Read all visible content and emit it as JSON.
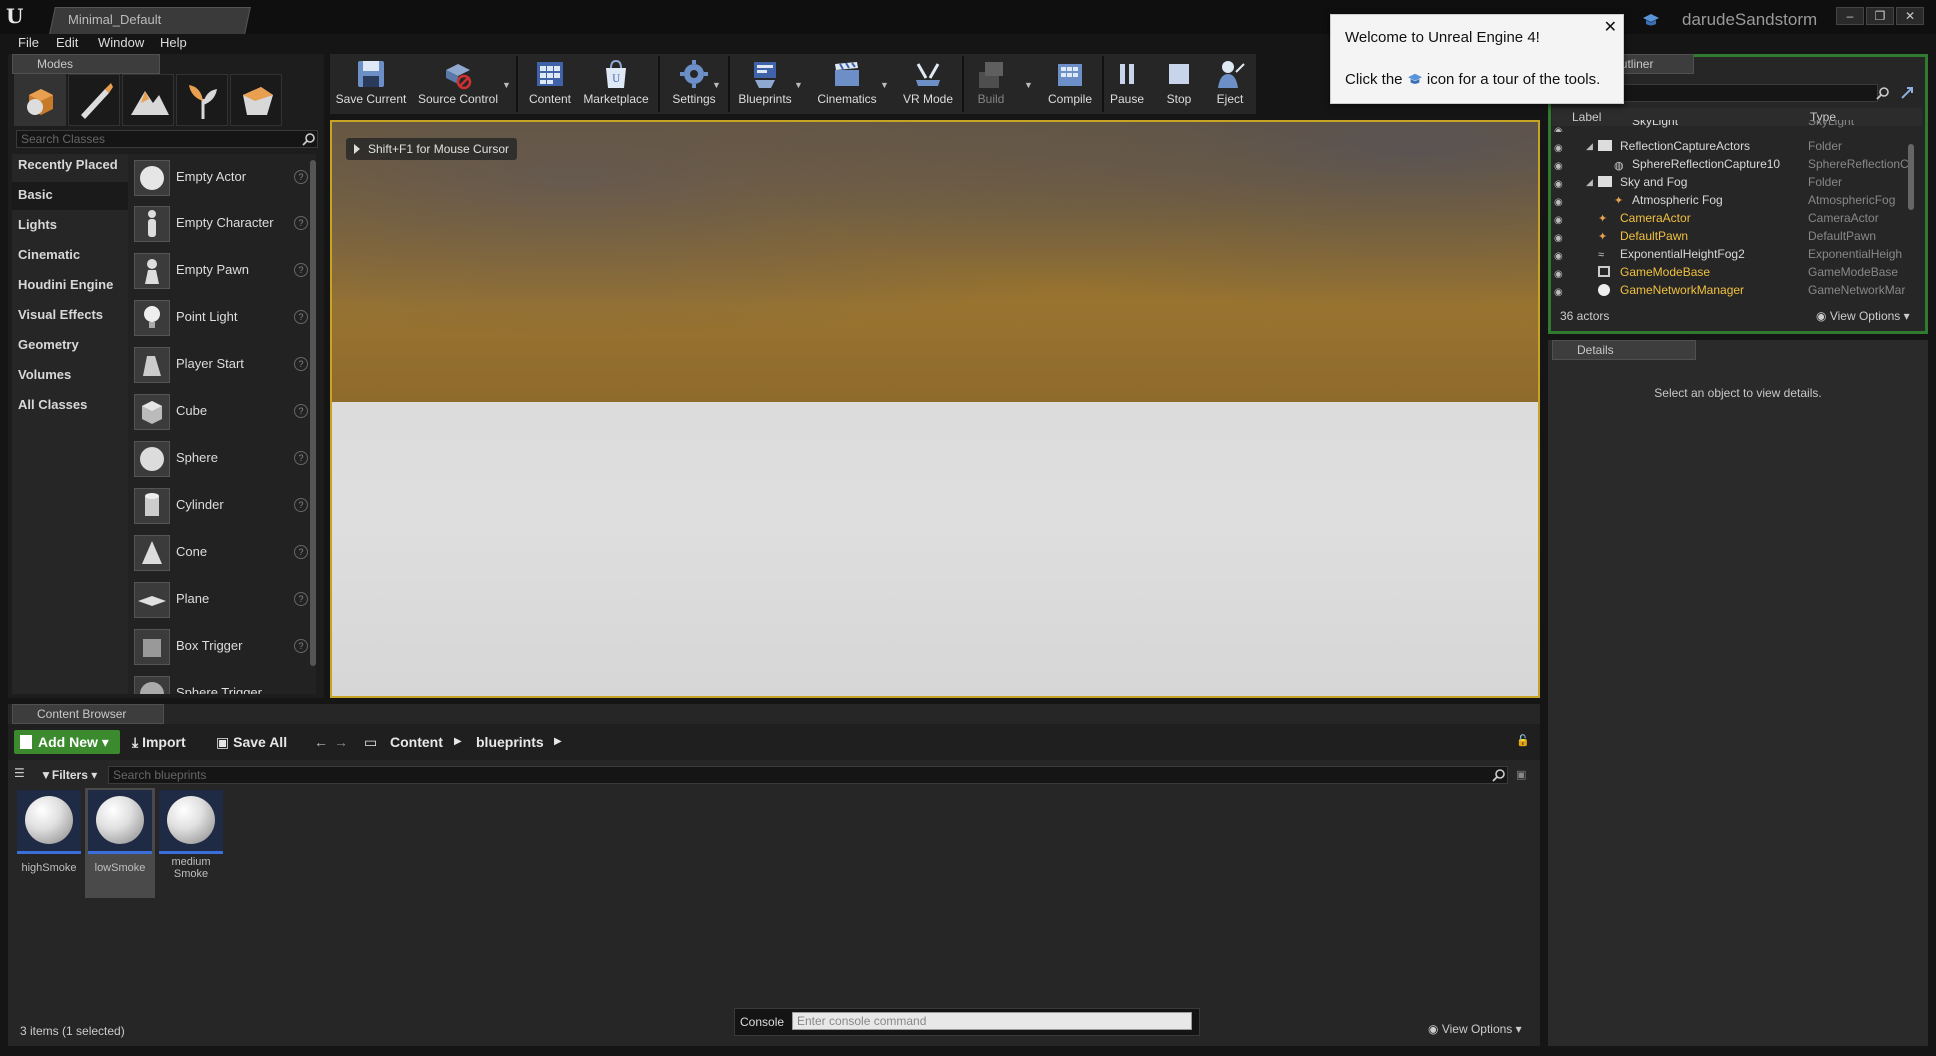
{
  "window": {
    "doc_tab": "Minimal_Default",
    "user": "darudeSandstorm",
    "controls": [
      "–",
      "❐",
      "✕"
    ]
  },
  "menu": [
    "File",
    "Edit",
    "Window",
    "Help"
  ],
  "modes": {
    "tab": "Modes",
    "search_placeholder": "Search Classes",
    "categories": [
      "Recently Placed",
      "Basic",
      "Lights",
      "Cinematic",
      "Houdini Engine",
      "Visual Effects",
      "Geometry",
      "Volumes",
      "All Classes"
    ],
    "selected_category": "Basic",
    "items": [
      "Empty Actor",
      "Empty Character",
      "Empty Pawn",
      "Point Light",
      "Player Start",
      "Cube",
      "Sphere",
      "Cylinder",
      "Cone",
      "Plane",
      "Box Trigger",
      "Sphere Trigger"
    ]
  },
  "toolbar": {
    "save_current": "Save Current",
    "source_control": "Source Control",
    "content": "Content",
    "marketplace": "Marketplace",
    "settings": "Settings",
    "blueprints": "Blueprints",
    "cinematics": "Cinematics",
    "vr_mode": "VR Mode",
    "build": "Build",
    "compile": "Compile",
    "pause": "Pause",
    "stop": "Stop",
    "eject": "Eject"
  },
  "viewport": {
    "hint": "Shift+F1 for Mouse Cursor"
  },
  "welcome": {
    "title": "Welcome to Unreal Engine 4!",
    "body_before": "Click the",
    "body_after": "icon for a tour of the tools."
  },
  "outliner": {
    "tab": "World Outliner",
    "col_label": "Label",
    "col_type": "Type",
    "rows": [
      {
        "label": "SkyLight",
        "type": "SkyLight"
      },
      {
        "label": "ReflectionCaptureActors",
        "type": "Folder"
      },
      {
        "label": "SphereReflectionCapture10",
        "type": "SphereReflectionC"
      },
      {
        "label": "Sky and Fog",
        "type": "Folder"
      },
      {
        "label": "Atmospheric Fog",
        "type": "AtmosphericFog"
      },
      {
        "label": "CameraActor",
        "type": "CameraActor"
      },
      {
        "label": "DefaultPawn",
        "type": "DefaultPawn"
      },
      {
        "label": "ExponentialHeightFog2",
        "type": "ExponentialHeigh"
      },
      {
        "label": "GameModeBase",
        "type": "GameModeBase"
      },
      {
        "label": "GameNetworkManager",
        "type": "GameNetworkMar"
      }
    ],
    "count": "36 actors",
    "view_options": "View Options"
  },
  "details": {
    "tab": "Details",
    "message": "Select an object to view details."
  },
  "content_browser": {
    "tab": "Content Browser",
    "add_new": "Add New",
    "import": "Import",
    "save_all": "Save All",
    "path": [
      "Content",
      "blueprints"
    ],
    "filters": "Filters",
    "search_placeholder": "Search blueprints",
    "assets": [
      {
        "name": "highSmoke"
      },
      {
        "name": "lowSmoke"
      },
      {
        "name": "medium Smoke"
      }
    ],
    "status": "3 items (1 selected)",
    "console_label": "Console",
    "console_placeholder": "Enter console command",
    "view_options": "View Options"
  },
  "colors": {
    "accent_green": "#3b8a2e",
    "viewport_border": "#c8a424",
    "asset_blue": "#3b6fd8",
    "outliner_gold": "#f0c040"
  }
}
